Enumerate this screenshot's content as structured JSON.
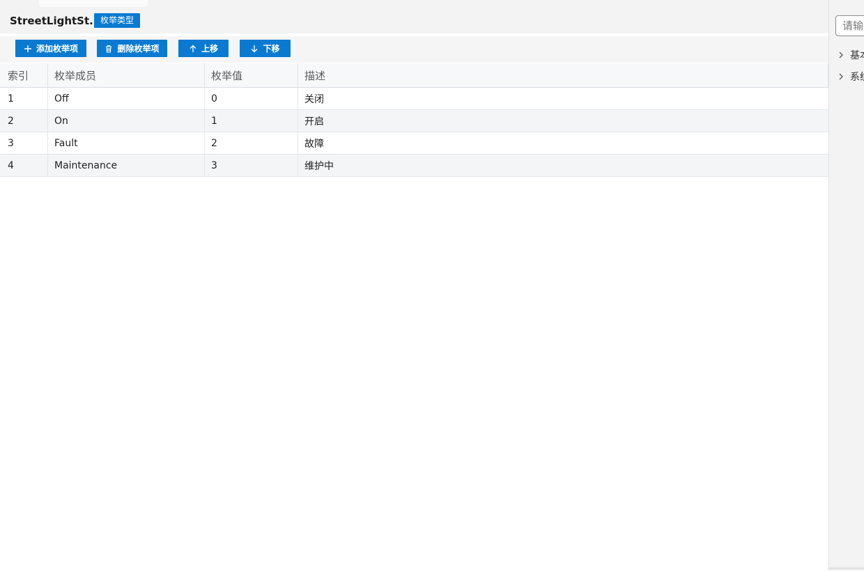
{
  "header": {
    "type_name": "StreetLightSt...",
    "type_badge": "枚举类型"
  },
  "toolbar": {
    "add_label": "添加枚举项",
    "delete_label": "删除枚举项",
    "up_label": "上移",
    "down_label": "下移"
  },
  "table": {
    "columns": [
      "索引",
      "枚举成员",
      "枚举值",
      "描述"
    ],
    "rows": [
      {
        "index": "1",
        "member": "Off",
        "value": "0",
        "desc": "关闭"
      },
      {
        "index": "2",
        "member": "On",
        "value": "1",
        "desc": "开启"
      },
      {
        "index": "3",
        "member": "Fault",
        "value": "2",
        "desc": "故障"
      },
      {
        "index": "4",
        "member": "Maintenance",
        "value": "3",
        "desc": "维护中"
      }
    ]
  },
  "right_panel": {
    "search_placeholder": "请输",
    "tree_items": [
      {
        "label": "基本"
      },
      {
        "label": "系统"
      }
    ]
  },
  "colors": {
    "accent": "#0a7ad1",
    "header_bg": "#f3f3f3",
    "row_alt": "#f4f5f7"
  }
}
